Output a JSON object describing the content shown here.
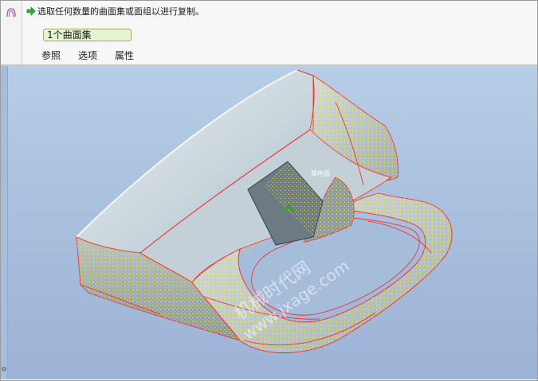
{
  "prompt": {
    "icon": "green-arrow-icon",
    "text": "选取任何数量的曲面集或面组以进行复制。"
  },
  "collector": {
    "value": "1个曲面集"
  },
  "tabs": [
    {
      "label": "参照"
    },
    {
      "label": "选项"
    },
    {
      "label": "属性"
    }
  ],
  "feature_icon": "copy-surface-icon",
  "viewport": {
    "selection_label": "零件面",
    "watermark_line1": "机械时代网",
    "watermark_line2": "www.jxage.com"
  },
  "colors": {
    "background_top": "#b7cee7",
    "background_bottom": "#9cb3d6",
    "highlight_edges": "#ff2020",
    "selection_mesh": "#ffff00",
    "model_surface": "#c9d6df",
    "collector_bg": "#e7f6cf"
  }
}
